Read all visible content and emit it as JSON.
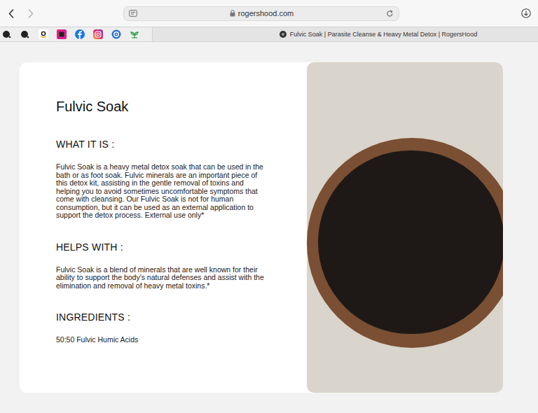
{
  "navigation": {
    "back_enabled": true,
    "forward_enabled": false
  },
  "address_bar": {
    "url": "rogershood.com"
  },
  "tab": {
    "title": "Fulvic Soak | Parasite Cleanse & Heavy Metal Detox | RogersHood",
    "selected": true
  },
  "product": {
    "title": "Fulvic Soak",
    "sections": [
      {
        "heading": "WHAT IT IS :",
        "body": "Fulvic Soak is a heavy metal detox soak that can be used in the bath or as foot soak. Fulvic minerals are an important piece of this detox kit, assisting in the gentle removal of toxins and helping you to avoid sometimes uncomfortable symptoms that come with cleansing. Our Fulvic Soak is not for human consumption, but it can be used as an external application to support the detox process. External use only*"
      },
      {
        "heading": "HELPS WITH :",
        "body": "Fulvic Soak is a blend of minerals that are well known for their ability to support the body's natural defenses and assist with the elimination and removal of heavy metal toxins.*"
      },
      {
        "heading": "INGREDIENTS :",
        "body": "50:50 Fulvic Humic Acids"
      }
    ]
  }
}
